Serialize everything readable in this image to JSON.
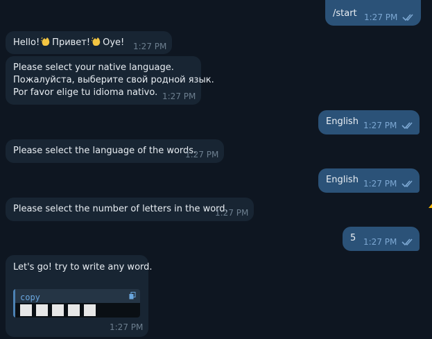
{
  "messages": [
    {
      "side": "out",
      "text": "/start",
      "time": "1:27 PM",
      "read": true
    },
    {
      "side": "in",
      "text": "Hello! 👋 Привет! 👋 Oye!",
      "parts": [
        "Hello!",
        "Привет!",
        "Oye!"
      ],
      "emoji": "waving-hand-emoji",
      "time": "1:27 PM"
    },
    {
      "side": "in",
      "lines": [
        "Please select your native language.",
        "Пожалуйста, выберите свой родной язык.",
        "Por favor elige tu idioma nativo."
      ],
      "time": "1:27 PM"
    },
    {
      "side": "out",
      "text": "English",
      "time": "1:27 PM",
      "read": true
    },
    {
      "side": "in",
      "text": "Please select the language of the words.",
      "time": "1:27 PM"
    },
    {
      "side": "out",
      "text": "English",
      "time": "1:27 PM",
      "read": true
    },
    {
      "side": "in",
      "text": "Please select the number of letters in the word.",
      "time": "1:27 PM"
    },
    {
      "side": "out",
      "text": "5",
      "time": "1:27 PM",
      "read": true
    },
    {
      "side": "in",
      "text": "Let's go! try to write any word.",
      "code": {
        "language": "copy",
        "blank_letters": 5
      },
      "time": "1:27 PM"
    }
  ],
  "icons": {
    "read_receipt": "double-check-icon",
    "copy": "copy-icon",
    "emoji": "waving-hand-emoji"
  },
  "colors": {
    "background": "#0e1621",
    "incoming_bubble": "#182533",
    "outgoing_bubble": "#2b5278",
    "time_incoming": "#6d7f8f",
    "time_outgoing": "#7da8d3",
    "code_accent": "#4c82b4"
  }
}
